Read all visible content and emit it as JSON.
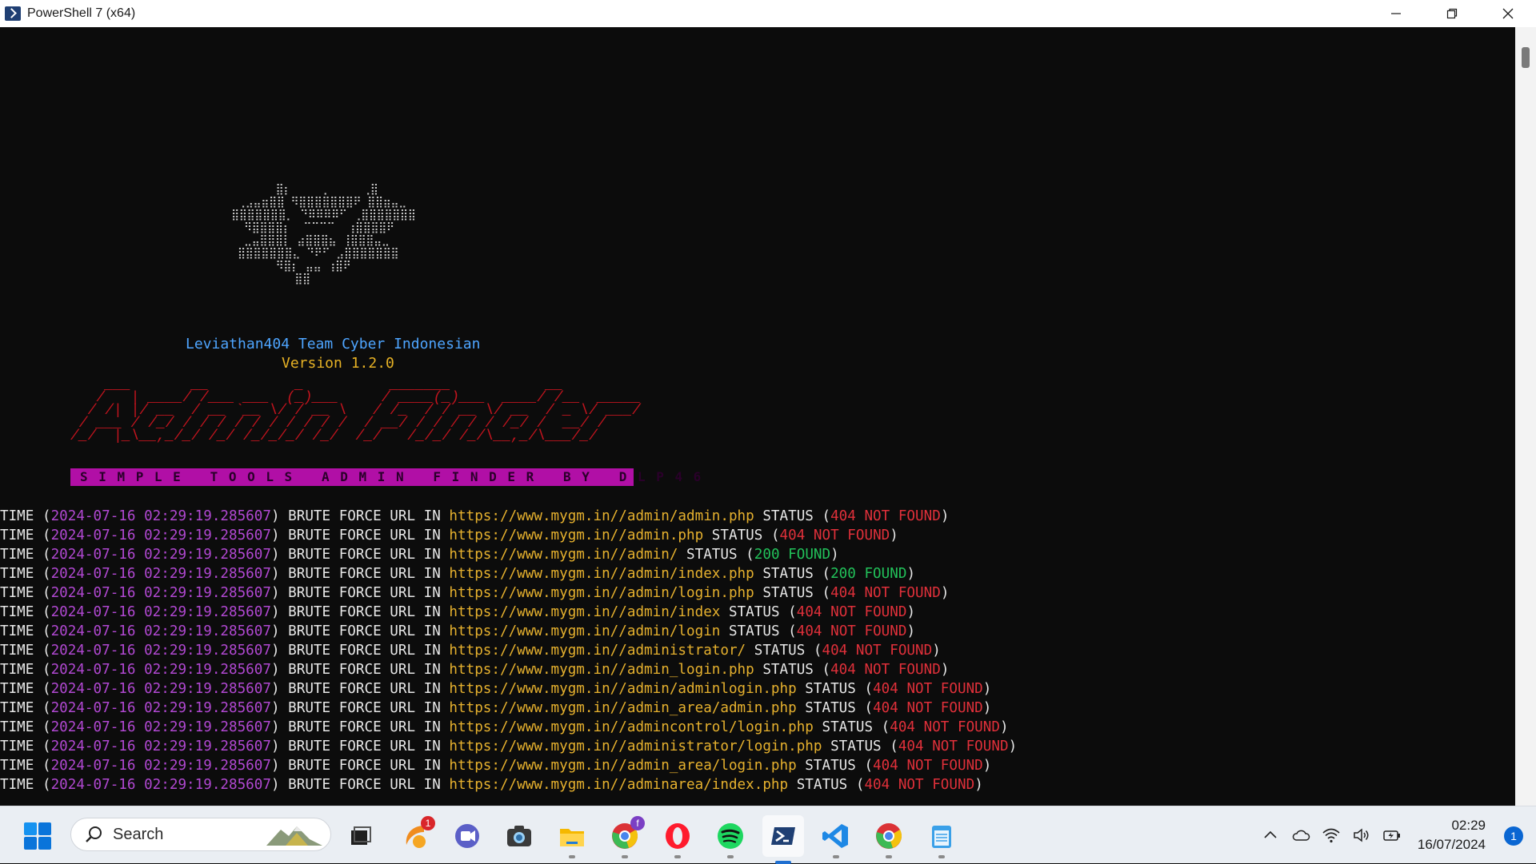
{
  "window": {
    "title": "PowerShell 7 (x64)"
  },
  "ascii_logo": "       ⣿⡆     ⡀     ⢀⣿\n ⢀⣠⣤⣶⣿⣿ ⠻⣿⣿⣿⣿⣿⣿⣿⠟ ⣿⣿⣶⣤⣀\n⣿⣿⣿⣿⣿⣿⣿⡀ ⠙⠿⠿⠿⠿⠋ ⢀⣿⣿⣿⣿⣿⣿⣿\n  ⠻⣿⣿⣿⣿⡆  ⠉⠉⠉⠉  ⢰⣿⣿⣿⣿⠟\n  ⣀⣤⣿⣿⣿⡇ ⣴⣿⣿⣿⣦ ⢸⣿⣿⣿⣤⣀\n ⣿⣿⣿⣿⣿⣿⣿⣄ ⠙⠟⠋ ⣠⣿⣿⣿⣿⣿⣿⣿\n       ⠻⣿⡆ ⣤⣤ ⢰⣿⠟\n          ⣿⣿",
  "team_label": "Leviathan404 Team Cyber Indonesian",
  "version_label": "Version 1.2.0",
  "banner": "    ___       __          _          _______           __\n   /   | ____/ /___ ___  (_)___     / ____(_)___  ____/ /__  _____\n  / /| |/ __  / __ `__ \\/ / __ \\   / /_  / / __ \\/ __  / _ \\/ ___/\n / ___ / /_/ / / / / / / / / / /  / __/ / / / / / /_/ /  __/ /\n/_/  |_\\__,_/_/ /_/ /_/_/_/ /_/  /_/   /_/_/ /_/\\__,_/\\___/_/",
  "subtitle": "SIMPLE TOOLS ADMIN FINDER BY DLP46",
  "log": {
    "prefix": "TIME (",
    "middle": ") BRUTE FORCE URL IN ",
    "status_label": " STATUS (",
    "suffix": ")",
    "lines": [
      {
        "time": "2024-07-16 02:29:19.285607",
        "url": "https://www.mygm.in//admin/admin.php",
        "code": "404",
        "result": "NOT FOUND"
      },
      {
        "time": "2024-07-16 02:29:19.285607",
        "url": "https://www.mygm.in//admin.php",
        "code": "404",
        "result": "NOT FOUND"
      },
      {
        "time": "2024-07-16 02:29:19.285607",
        "url": "https://www.mygm.in//admin/",
        "code": "200",
        "result": "FOUND"
      },
      {
        "time": "2024-07-16 02:29:19.285607",
        "url": "https://www.mygm.in//admin/index.php",
        "code": "200",
        "result": "FOUND"
      },
      {
        "time": "2024-07-16 02:29:19.285607",
        "url": "https://www.mygm.in//admin/login.php",
        "code": "404",
        "result": "NOT FOUND"
      },
      {
        "time": "2024-07-16 02:29:19.285607",
        "url": "https://www.mygm.in//admin/index",
        "code": "404",
        "result": "NOT FOUND"
      },
      {
        "time": "2024-07-16 02:29:19.285607",
        "url": "https://www.mygm.in//admin/login",
        "code": "404",
        "result": "NOT FOUND"
      },
      {
        "time": "2024-07-16 02:29:19.285607",
        "url": "https://www.mygm.in//administrator/",
        "code": "404",
        "result": "NOT FOUND"
      },
      {
        "time": "2024-07-16 02:29:19.285607",
        "url": "https://www.mygm.in//admin_login.php",
        "code": "404",
        "result": "NOT FOUND"
      },
      {
        "time": "2024-07-16 02:29:19.285607",
        "url": "https://www.mygm.in//admin/adminlogin.php",
        "code": "404",
        "result": "NOT FOUND"
      },
      {
        "time": "2024-07-16 02:29:19.285607",
        "url": "https://www.mygm.in//admin_area/admin.php",
        "code": "404",
        "result": "NOT FOUND"
      },
      {
        "time": "2024-07-16 02:29:19.285607",
        "url": "https://www.mygm.in//admincontrol/login.php",
        "code": "404",
        "result": "NOT FOUND"
      },
      {
        "time": "2024-07-16 02:29:19.285607",
        "url": "https://www.mygm.in//administrator/login.php",
        "code": "404",
        "result": "NOT FOUND"
      },
      {
        "time": "2024-07-16 02:29:19.285607",
        "url": "https://www.mygm.in//admin_area/login.php",
        "code": "404",
        "result": "NOT FOUND"
      },
      {
        "time": "2024-07-16 02:29:19.285607",
        "url": "https://www.mygm.in//adminarea/index.php",
        "code": "404",
        "result": "NOT FOUND"
      }
    ]
  },
  "taskbar": {
    "search_placeholder": "Search",
    "badges": {
      "weather": "1",
      "chrome_profile": "f"
    },
    "clock_time": "02:29",
    "clock_date": "16/07/2024",
    "notification_count": "1"
  },
  "colors": {
    "terminal_bg": "#0c0c0c",
    "timestamp": "#b148d2",
    "url": "#e6b12e",
    "status_404": "#e0303a",
    "status_200": "#22c25a",
    "team_label": "#4ea5ff",
    "version_label": "#e7b225",
    "banner": "#c4141e",
    "subtitle_bg": "#b10fa6"
  },
  "icons": [
    "powershell-icon",
    "minimize-icon",
    "maximize-icon",
    "close-icon",
    "windows-start-icon",
    "search-icon",
    "task-view-icon",
    "weather-icon",
    "teams-icon",
    "camera-icon",
    "file-explorer-icon",
    "chrome-profile-icon",
    "opera-icon",
    "spotify-icon",
    "powershell-icon",
    "vscode-icon",
    "chrome-icon",
    "notepad-icon",
    "chevron-up-icon",
    "onedrive-icon",
    "wifi-icon",
    "volume-icon",
    "battery-icon"
  ]
}
